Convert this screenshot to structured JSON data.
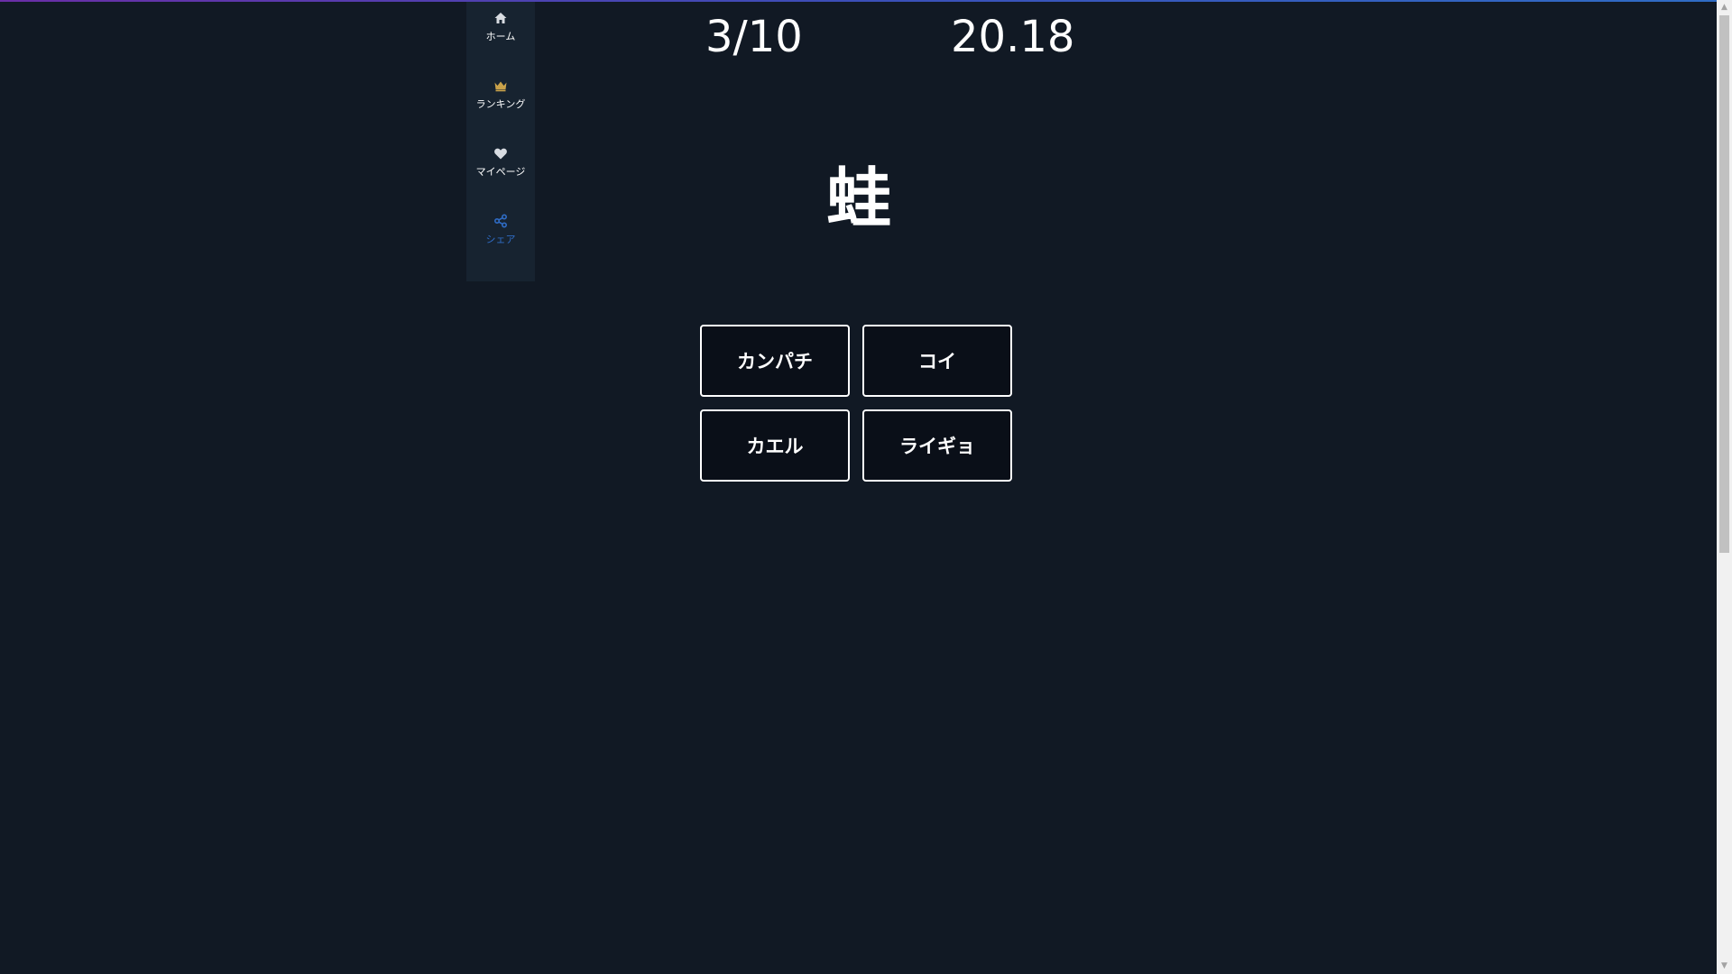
{
  "sidebar": {
    "items": [
      {
        "label": "ホーム",
        "icon": "home-icon"
      },
      {
        "label": "ランキング",
        "icon": "crown-icon"
      },
      {
        "label": "マイページ",
        "icon": "heart-icon"
      },
      {
        "label": "シェア",
        "icon": "share-icon"
      }
    ]
  },
  "game": {
    "progress": "3/10",
    "timer": "20.18",
    "question": "蛙",
    "choices": [
      "カンパチ",
      "コイ",
      "カエル",
      "ライギョ"
    ]
  },
  "colors": {
    "background": "#111924",
    "sidebar": "#172330",
    "accent": "#2f6cc5",
    "crown": "#c9a24a"
  }
}
